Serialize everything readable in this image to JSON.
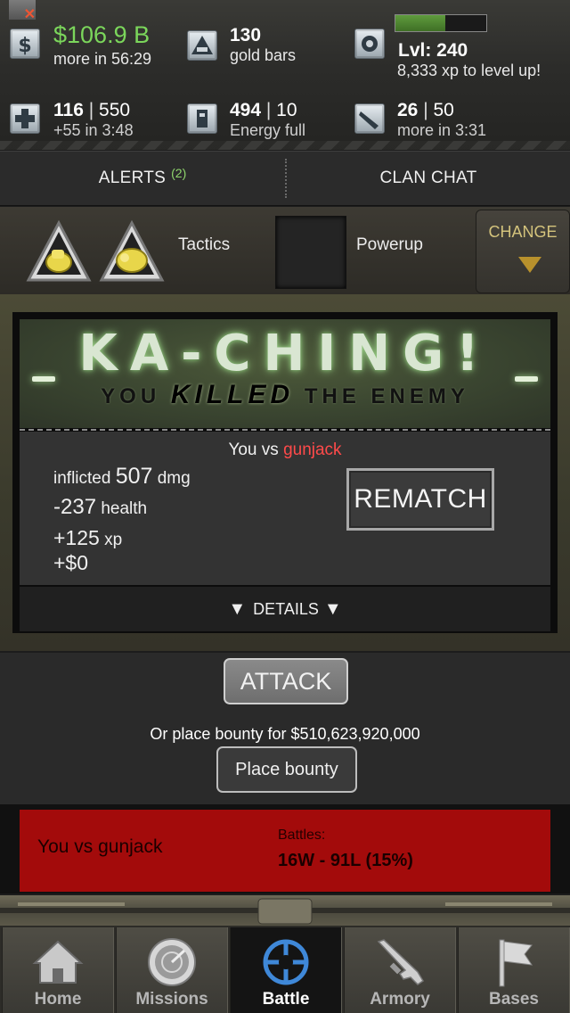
{
  "status": {
    "cash": {
      "amount": "$106.9 B",
      "timer": "more in 56:29"
    },
    "gold": {
      "count": "130",
      "label": "gold bars"
    },
    "level": {
      "label": "Lvl: 240",
      "xp_to_level": "8,333 xp to level up!",
      "progress": 0.55
    },
    "health": {
      "current": "116",
      "max": "550",
      "regen": "+55 in 3:48"
    },
    "energy": {
      "current": "494",
      "max": "10",
      "status": "Energy full"
    },
    "stamina": {
      "current": "26",
      "max": "50",
      "timer": "more in 3:31"
    }
  },
  "alerts_bar": {
    "alerts_label": "ALERTS",
    "alerts_count": "(2)",
    "clan_chat_label": "CLAN CHAT"
  },
  "loadout": {
    "tactics_label": "Tactics",
    "powerup_label": "Powerup",
    "change_label": "CHANGE"
  },
  "result": {
    "headline": "KA-CHING!",
    "subline_pre": "YOU",
    "subline_kill": "KILLED",
    "subline_post": "THE ENEMY",
    "versus_prefix": "You vs",
    "opponent": "gunjack",
    "inflicted_prefix": "inflicted",
    "inflicted_value": "507",
    "inflicted_unit": "dmg",
    "health_value": "-237",
    "health_unit": "health",
    "xp_value": "+125",
    "xp_unit": "xp",
    "cash_value": "+$0",
    "rematch_label": "REMATCH",
    "details_label": "DETAILS"
  },
  "actions": {
    "attack_label": "ATTACK",
    "bounty_text": "Or place bounty for $510,623,920,000",
    "place_bounty_label": "Place bounty"
  },
  "record": {
    "versus": "You vs gunjack",
    "battles_label": "Battles:",
    "battles_value": "16W - 91L (15%)"
  },
  "tabs": [
    {
      "label": "Home",
      "icon": "home-icon"
    },
    {
      "label": "Missions",
      "icon": "radar-icon"
    },
    {
      "label": "Battle",
      "icon": "crosshair-icon"
    },
    {
      "label": "Armory",
      "icon": "rifle-icon"
    },
    {
      "label": "Bases",
      "icon": "flag-icon"
    }
  ],
  "colors": {
    "cash_green": "#7bd65b",
    "alert_count_green": "#8fd66c",
    "opponent_red": "#ff4a4a",
    "record_red": "#a30b0b",
    "change_yellow": "#d4c37c"
  }
}
